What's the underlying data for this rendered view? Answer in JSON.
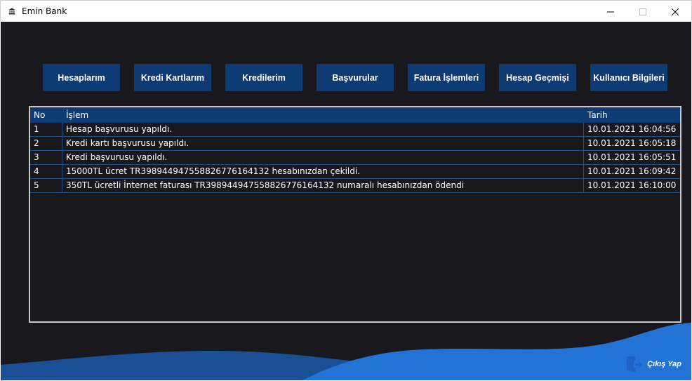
{
  "window": {
    "title": "Emin Bank",
    "icon": "bank-icon"
  },
  "nav": {
    "buttons": [
      {
        "label": "Hesaplarım"
      },
      {
        "label": "Kredi Kartlarım"
      },
      {
        "label": "Kredilerim"
      },
      {
        "label": "Başvurular"
      },
      {
        "label": "Fatura İşlemleri"
      },
      {
        "label": "Hesap Geçmişi"
      },
      {
        "label": "Kullanıcı Bilgileri"
      }
    ]
  },
  "history_table": {
    "columns": [
      "No",
      "İşlem",
      "Tarih"
    ],
    "rows": [
      {
        "no": "1",
        "islem": "Hesap başvurusu yapıldı.",
        "tarih": "10.01.2021 16:04:56"
      },
      {
        "no": "2",
        "islem": "Kredi kartı başvurusu yapıldı.",
        "tarih": "10.01.2021 16:05:18"
      },
      {
        "no": "3",
        "islem": "Kredi başvurusu yapıldı.",
        "tarih": "10.01.2021 16:05:51"
      },
      {
        "no": "4",
        "islem": "15000TL ücret TR398944947558826776164132 hesabınızdan çekildi.",
        "tarih": "10.01.2021 16:09:42"
      },
      {
        "no": "5",
        "islem": "350TL ücretli İnternet faturası TR398944947558826776164132 numaralı hesabınızdan ödendi",
        "tarih": "10.01.2021 16:10:00"
      }
    ]
  },
  "logout": {
    "label": "Çıkış Yap",
    "icon": "logout-icon"
  },
  "colors": {
    "background": "#19191d",
    "accent": "#0f3b74",
    "wave_light": "#2372d6",
    "wave_dark": "#1a4f96"
  }
}
